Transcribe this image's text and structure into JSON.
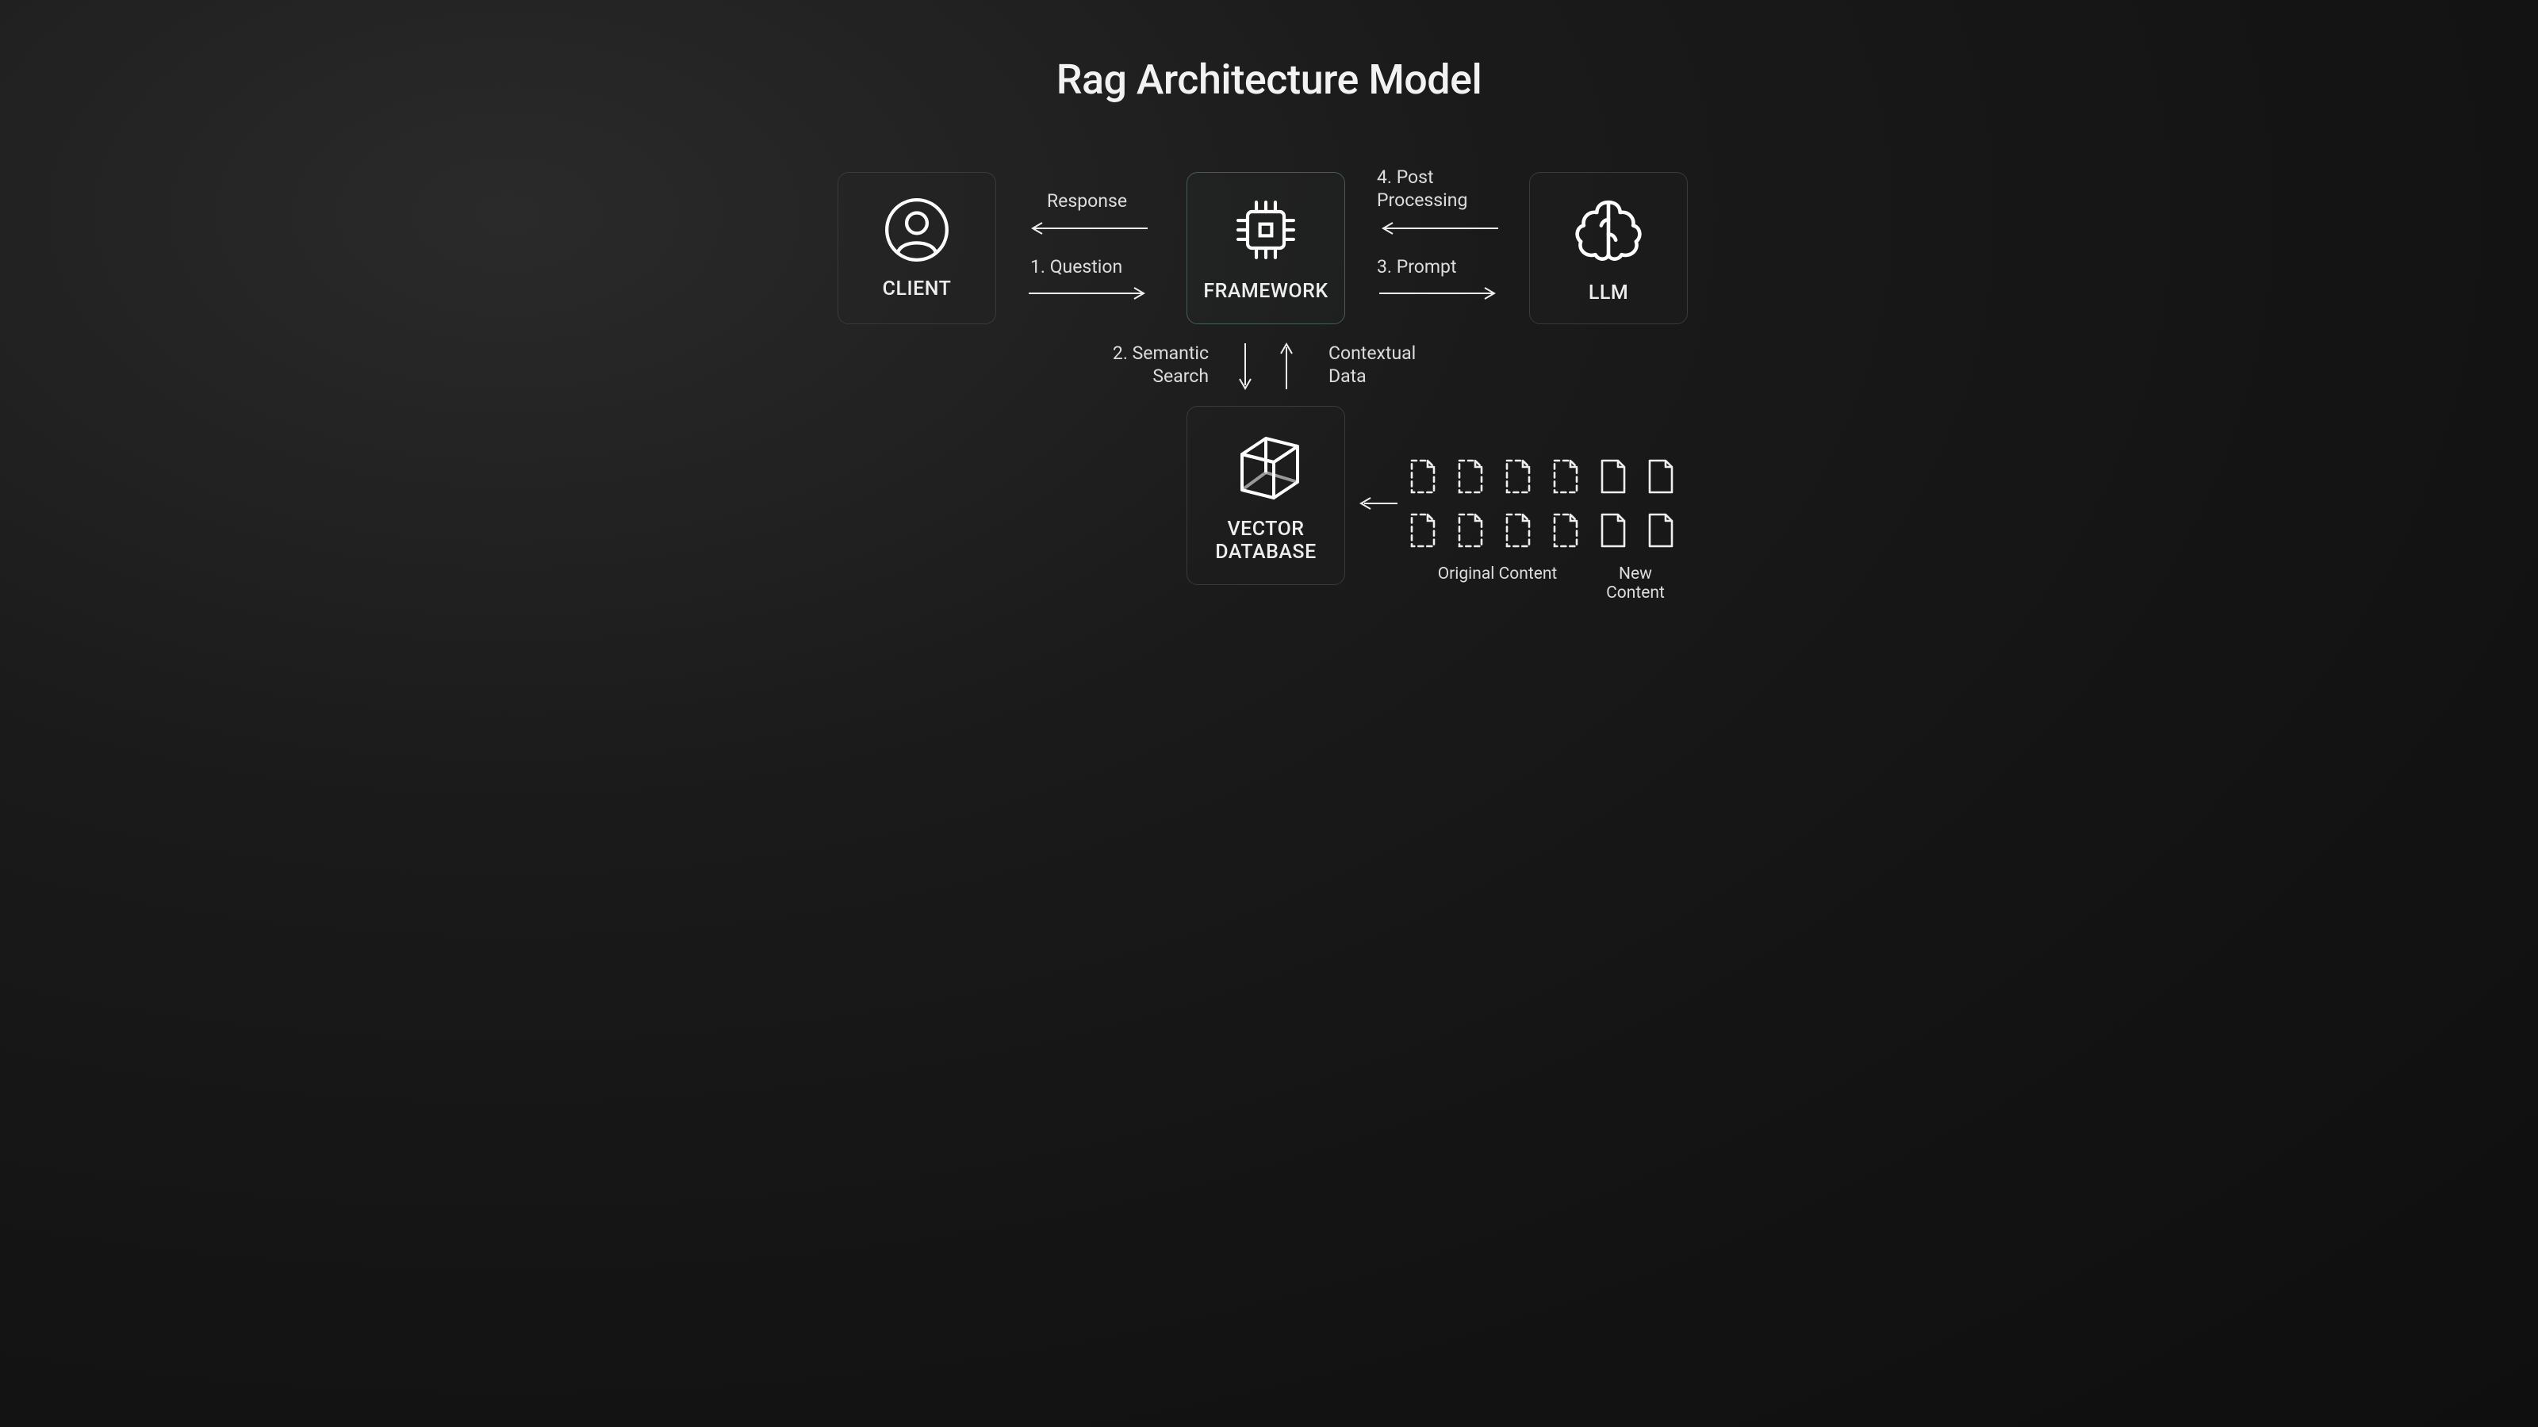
{
  "title": "Rag Architecture Model",
  "nodes": {
    "client": "CLIENT",
    "framework": "FRAMEWORK",
    "llm": "LLM",
    "vector": "VECTOR\nDATABASE"
  },
  "flows": {
    "response": "Response",
    "question": "1. Question",
    "semantic": "2. Semantic\nSearch",
    "contextual": "Contextual\nData",
    "prompt": "3. Prompt",
    "post": "4. Post\nProcessing"
  },
  "docs": {
    "original_label": "Original Content",
    "new_label": "New Content"
  }
}
